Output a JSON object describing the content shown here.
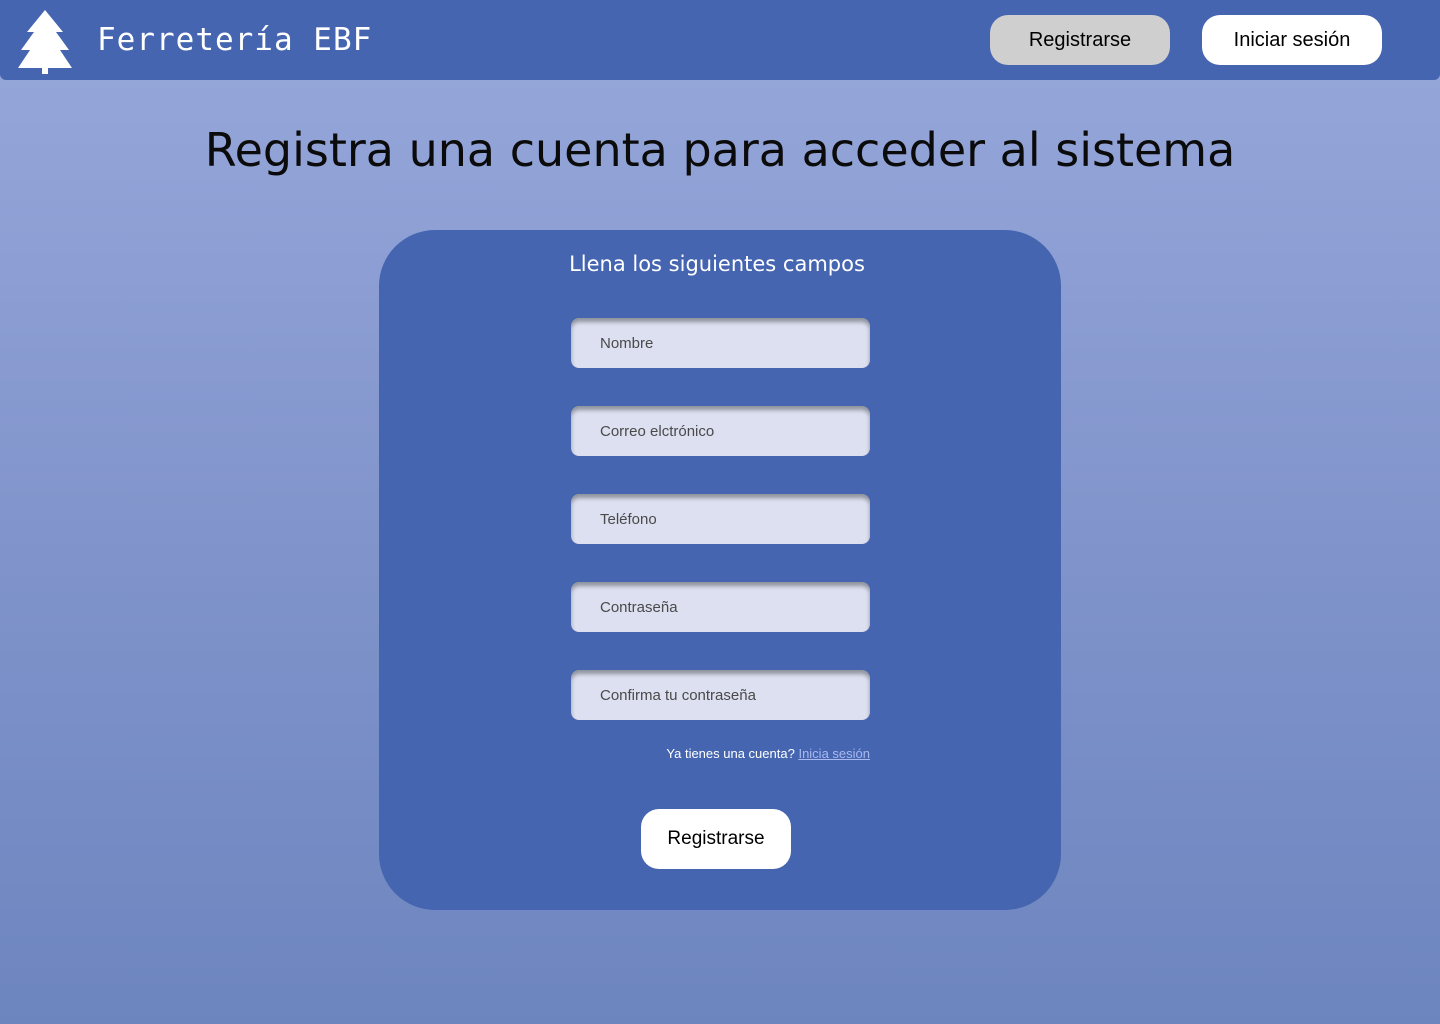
{
  "header": {
    "brand": "Ferretería EBF",
    "logo_icon": "pine-tree-icon",
    "register_label": "Registrarse",
    "login_label": "Iniciar sesión"
  },
  "main": {
    "title": "Registra una cuenta para acceder al sistema"
  },
  "form": {
    "heading": "Llena los siguientes campos",
    "fields": [
      {
        "placeholder": "Nombre"
      },
      {
        "placeholder": "Correo elctrónico"
      },
      {
        "placeholder": "Teléfono"
      },
      {
        "placeholder": "Contraseña"
      },
      {
        "placeholder": "Confirma tu contraseña"
      }
    ],
    "account_prompt": "Ya tienes una cuenta?",
    "login_link": "Inicia sesión",
    "submit_label": "Registrarse"
  },
  "colors": {
    "navbar": "#4565b0",
    "card": "#4565b0",
    "background_top": "#97a8db",
    "background_bottom": "#6d85bf",
    "register_button": "#cfcfcf",
    "input_background": "#dce0f0",
    "link": "#a9b9f0"
  }
}
